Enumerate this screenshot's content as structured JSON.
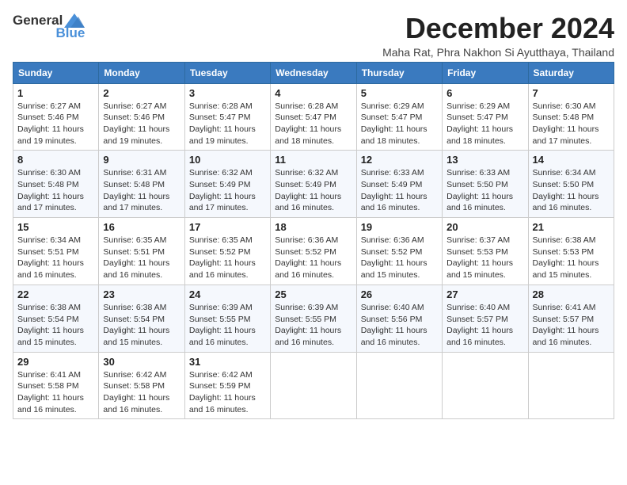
{
  "logo": {
    "general": "General",
    "blue": "Blue"
  },
  "header": {
    "month": "December 2024",
    "location": "Maha Rat, Phra Nakhon Si Ayutthaya, Thailand"
  },
  "weekdays": [
    "Sunday",
    "Monday",
    "Tuesday",
    "Wednesday",
    "Thursday",
    "Friday",
    "Saturday"
  ],
  "weeks": [
    [
      {
        "day": "1",
        "sunrise": "6:27 AM",
        "sunset": "5:46 PM",
        "daylight": "11 hours and 19 minutes."
      },
      {
        "day": "2",
        "sunrise": "6:27 AM",
        "sunset": "5:46 PM",
        "daylight": "11 hours and 19 minutes."
      },
      {
        "day": "3",
        "sunrise": "6:28 AM",
        "sunset": "5:47 PM",
        "daylight": "11 hours and 19 minutes."
      },
      {
        "day": "4",
        "sunrise": "6:28 AM",
        "sunset": "5:47 PM",
        "daylight": "11 hours and 18 minutes."
      },
      {
        "day": "5",
        "sunrise": "6:29 AM",
        "sunset": "5:47 PM",
        "daylight": "11 hours and 18 minutes."
      },
      {
        "day": "6",
        "sunrise": "6:29 AM",
        "sunset": "5:47 PM",
        "daylight": "11 hours and 18 minutes."
      },
      {
        "day": "7",
        "sunrise": "6:30 AM",
        "sunset": "5:48 PM",
        "daylight": "11 hours and 17 minutes."
      }
    ],
    [
      {
        "day": "8",
        "sunrise": "6:30 AM",
        "sunset": "5:48 PM",
        "daylight": "11 hours and 17 minutes."
      },
      {
        "day": "9",
        "sunrise": "6:31 AM",
        "sunset": "5:48 PM",
        "daylight": "11 hours and 17 minutes."
      },
      {
        "day": "10",
        "sunrise": "6:32 AM",
        "sunset": "5:49 PM",
        "daylight": "11 hours and 17 minutes."
      },
      {
        "day": "11",
        "sunrise": "6:32 AM",
        "sunset": "5:49 PM",
        "daylight": "11 hours and 16 minutes."
      },
      {
        "day": "12",
        "sunrise": "6:33 AM",
        "sunset": "5:49 PM",
        "daylight": "11 hours and 16 minutes."
      },
      {
        "day": "13",
        "sunrise": "6:33 AM",
        "sunset": "5:50 PM",
        "daylight": "11 hours and 16 minutes."
      },
      {
        "day": "14",
        "sunrise": "6:34 AM",
        "sunset": "5:50 PM",
        "daylight": "11 hours and 16 minutes."
      }
    ],
    [
      {
        "day": "15",
        "sunrise": "6:34 AM",
        "sunset": "5:51 PM",
        "daylight": "11 hours and 16 minutes."
      },
      {
        "day": "16",
        "sunrise": "6:35 AM",
        "sunset": "5:51 PM",
        "daylight": "11 hours and 16 minutes."
      },
      {
        "day": "17",
        "sunrise": "6:35 AM",
        "sunset": "5:52 PM",
        "daylight": "11 hours and 16 minutes."
      },
      {
        "day": "18",
        "sunrise": "6:36 AM",
        "sunset": "5:52 PM",
        "daylight": "11 hours and 16 minutes."
      },
      {
        "day": "19",
        "sunrise": "6:36 AM",
        "sunset": "5:52 PM",
        "daylight": "11 hours and 15 minutes."
      },
      {
        "day": "20",
        "sunrise": "6:37 AM",
        "sunset": "5:53 PM",
        "daylight": "11 hours and 15 minutes."
      },
      {
        "day": "21",
        "sunrise": "6:38 AM",
        "sunset": "5:53 PM",
        "daylight": "11 hours and 15 minutes."
      }
    ],
    [
      {
        "day": "22",
        "sunrise": "6:38 AM",
        "sunset": "5:54 PM",
        "daylight": "11 hours and 15 minutes."
      },
      {
        "day": "23",
        "sunrise": "6:38 AM",
        "sunset": "5:54 PM",
        "daylight": "11 hours and 15 minutes."
      },
      {
        "day": "24",
        "sunrise": "6:39 AM",
        "sunset": "5:55 PM",
        "daylight": "11 hours and 16 minutes."
      },
      {
        "day": "25",
        "sunrise": "6:39 AM",
        "sunset": "5:55 PM",
        "daylight": "11 hours and 16 minutes."
      },
      {
        "day": "26",
        "sunrise": "6:40 AM",
        "sunset": "5:56 PM",
        "daylight": "11 hours and 16 minutes."
      },
      {
        "day": "27",
        "sunrise": "6:40 AM",
        "sunset": "5:57 PM",
        "daylight": "11 hours and 16 minutes."
      },
      {
        "day": "28",
        "sunrise": "6:41 AM",
        "sunset": "5:57 PM",
        "daylight": "11 hours and 16 minutes."
      }
    ],
    [
      {
        "day": "29",
        "sunrise": "6:41 AM",
        "sunset": "5:58 PM",
        "daylight": "11 hours and 16 minutes."
      },
      {
        "day": "30",
        "sunrise": "6:42 AM",
        "sunset": "5:58 PM",
        "daylight": "11 hours and 16 minutes."
      },
      {
        "day": "31",
        "sunrise": "6:42 AM",
        "sunset": "5:59 PM",
        "daylight": "11 hours and 16 minutes."
      },
      null,
      null,
      null,
      null
    ]
  ]
}
